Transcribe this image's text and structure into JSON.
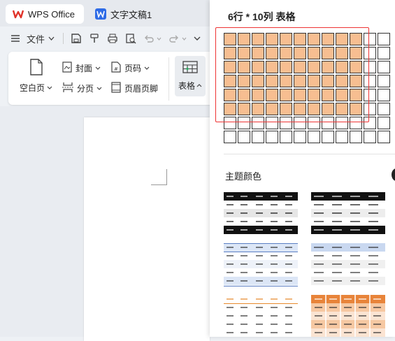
{
  "tabs": [
    {
      "label": "WPS Office",
      "icon": "wps-logo-icon"
    },
    {
      "label": "文字文稿1",
      "icon": "word-doc-icon"
    }
  ],
  "toolbar": {
    "file_label": "文件",
    "icons": [
      "menu-icon",
      "save-icon",
      "format-painter-icon",
      "print-icon",
      "print-preview-icon",
      "undo-icon",
      "redo-icon",
      "more-chevron-icon"
    ]
  },
  "ribbon": {
    "blank_page": "空白页",
    "cover": "封面",
    "page_number": "页码",
    "page_break": "分页",
    "header_footer": "页眉页脚",
    "table": "表格"
  },
  "table_panel": {
    "title": "6行 * 10列 表格",
    "rows": 8,
    "cols": 12,
    "selected_rows": 6,
    "selected_cols": 10,
    "highlight_color": "#f7be91",
    "selection_border": "#e33333",
    "theme_colors_label": "主题颜色",
    "styles": [
      {
        "name": "black-banded",
        "accent": "#111111"
      },
      {
        "name": "black-header",
        "accent": "#111111"
      },
      {
        "name": "blue-lines",
        "accent": "#5b7fc4"
      },
      {
        "name": "blue-light",
        "accent": "#c9d8f0"
      },
      {
        "name": "orange-lines",
        "accent": "#e88a2d"
      },
      {
        "name": "orange-filled",
        "accent": "#e8843a"
      }
    ]
  }
}
